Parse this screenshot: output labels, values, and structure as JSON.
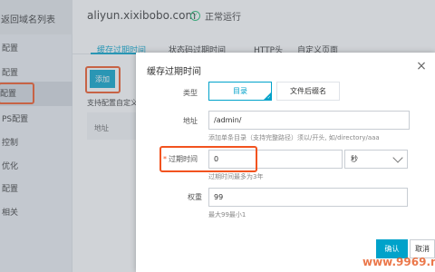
{
  "sidebar": {
    "back_label": "返回域名列表",
    "items": [
      {
        "label": "配置"
      },
      {
        "label": "配置"
      },
      {
        "label": "配置"
      },
      {
        "label": "PS配置"
      },
      {
        "label": "控制"
      },
      {
        "label": "优化"
      },
      {
        "label": "配置"
      },
      {
        "label": "相关"
      }
    ]
  },
  "header": {
    "domain": "aliyun.xixibobo.com",
    "status": "正常运行",
    "status_icon": "check-circle-icon"
  },
  "tabs": [
    "缓存过期时间",
    "状态码过期时间",
    "HTTP头",
    "自定义页面"
  ],
  "main": {
    "add_label": "添加",
    "support_text": "支持配置自定义",
    "table_header": "地址"
  },
  "dialog": {
    "title": "缓存过期时间",
    "close_icon": "close-icon",
    "type_label": "类型",
    "type_options": [
      "目录",
      "文件后缀名"
    ],
    "type_selected": "目录",
    "address_label": "地址",
    "address_value": "/admin/",
    "address_hint": "添加单条目录（支持完整路径）须以/开头, 如/directory/aaa",
    "expire_label": "过期时间",
    "expire_value": "0",
    "expire_unit": "秒",
    "expire_hint": "过期时间最多为3年",
    "weight_label": "权重",
    "weight_value": "99",
    "weight_hint": "最大99最小1",
    "ok_label": "确认",
    "cancel_label": "取消"
  },
  "watermark": "www.9969.n",
  "colors": {
    "accent": "#00a2ca",
    "highlight": "#f2531f",
    "status_green": "#1ebd74"
  }
}
